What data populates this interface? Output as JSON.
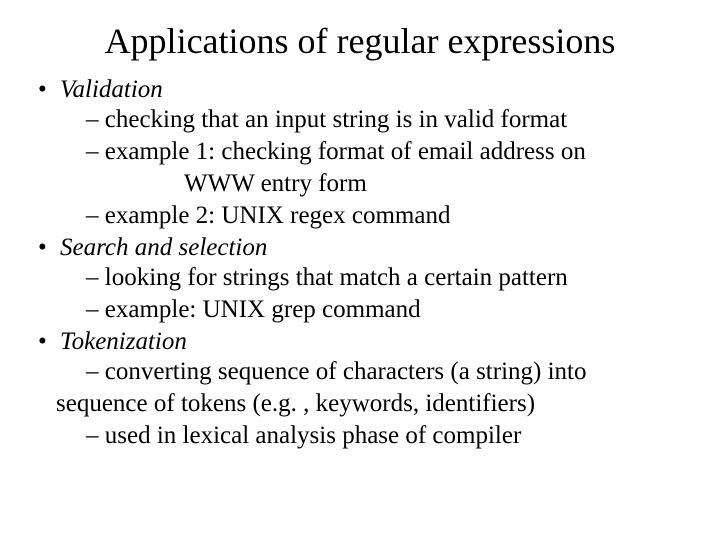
{
  "title": "Applications of regular expressions",
  "items": [
    {
      "topic": "Validation",
      "subs": [
        {
          "text": "checking that an input string is in valid format"
        },
        {
          "text": "example 1: checking format of email address on",
          "cont": "WWW entry form"
        },
        {
          "text": "example 2: UNIX regex command"
        }
      ]
    },
    {
      "topic": "Search and selection",
      "subs": [
        {
          "text": "looking for strings that match a certain pattern"
        },
        {
          "text": "example: UNIX grep command"
        }
      ]
    },
    {
      "topic": "Tokenization",
      "subs": [
        {
          "text": "converting sequence of characters (a string) into",
          "cont2": "sequence of tokens (e.g. , keywords, identifiers)"
        },
        {
          "text": "used in lexical analysis phase of compiler"
        }
      ]
    }
  ]
}
